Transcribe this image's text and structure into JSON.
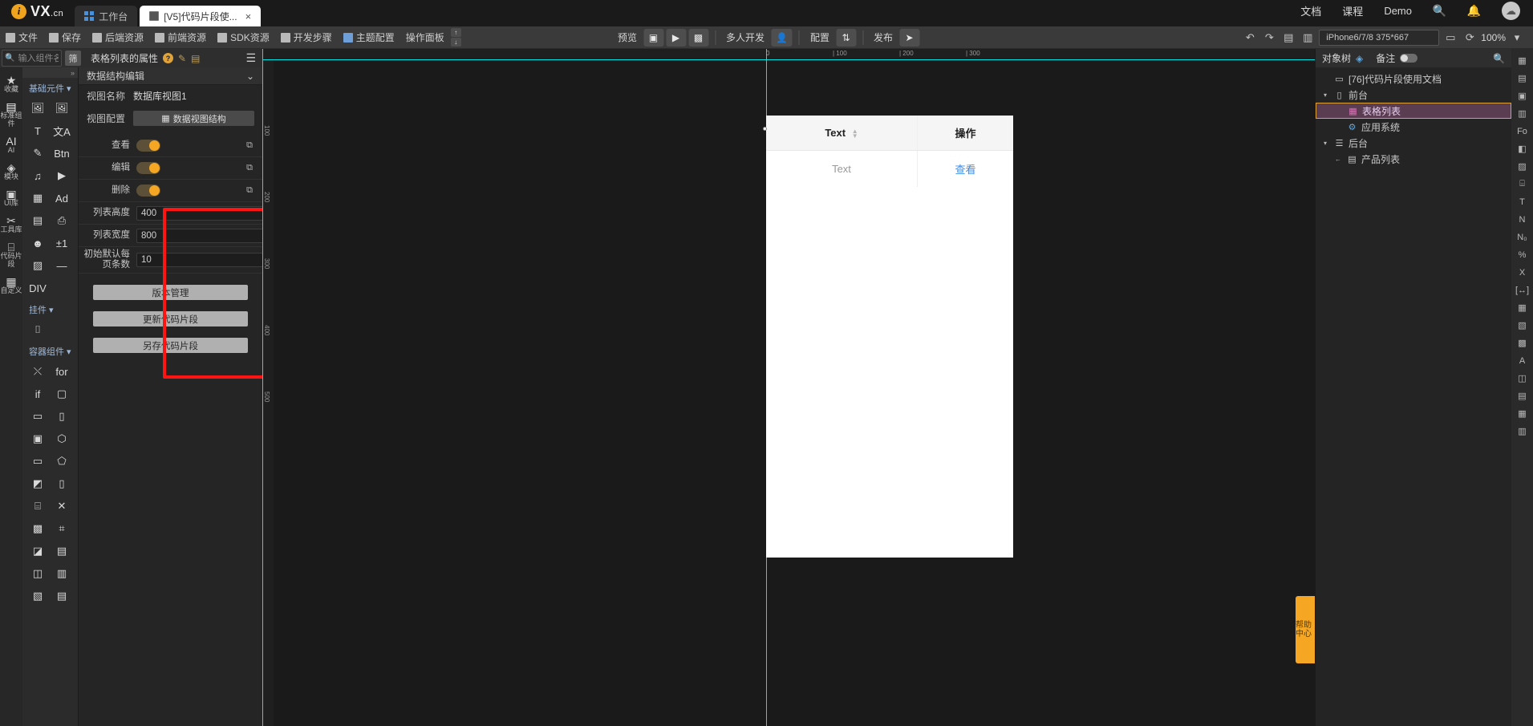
{
  "app": {
    "logo_text": "VX",
    "logo_suffix": ".cn",
    "logo_badge": "i"
  },
  "tabs": [
    {
      "label": "工作台",
      "icon": "grid-icon",
      "active": false
    },
    {
      "label": "[V5]代码片段使...",
      "icon": "monitor-icon",
      "active": true,
      "close": "×"
    }
  ],
  "top_right": {
    "items": [
      "文档",
      "课程",
      "Demo"
    ],
    "search_icon": "🔍",
    "bell_icon": "🔔",
    "avatar_icon": "☁"
  },
  "toolbar": {
    "left_items": [
      {
        "label": "文件",
        "icon": "folder-icon"
      },
      {
        "label": "保存",
        "icon": "save-icon"
      },
      {
        "label": "后端资源",
        "icon": "server-icon"
      },
      {
        "label": "前端资源",
        "icon": "blocks-icon"
      },
      {
        "label": "SDK资源",
        "icon": "sdk-icon"
      },
      {
        "label": "开发步骤",
        "icon": "steps-icon"
      },
      {
        "label": "主题配置",
        "icon": "theme-icon"
      },
      {
        "label": "操作面板",
        "icon": "panel-icon"
      }
    ],
    "stepper": {
      "up": "↑",
      "down": "↓"
    },
    "center_items": [
      {
        "label": "预览",
        "icon": ""
      },
      {
        "label": "",
        "icon": "page-play-icon"
      },
      {
        "label": "",
        "icon": "play-icon"
      },
      {
        "label": "",
        "icon": "qrcode-icon"
      },
      {
        "label": "多人开发",
        "icon": "people-icon"
      },
      {
        "label": "配置",
        "icon": "sliders-icon"
      },
      {
        "label": "发布",
        "icon": "send-icon"
      }
    ],
    "right": {
      "undo_icon": "↶",
      "redo_icon": "↷",
      "align_icon": "▤",
      "columns_icon": "▥",
      "device": "iPhone6/7/8 375*667",
      "screen_icon": "▭",
      "rotate_icon": "⟳",
      "zoom": "100%",
      "zoom_caret": "▾"
    }
  },
  "left_panel": {
    "search_placeholder": "输入组件名称",
    "filter_label": "筛",
    "collapse_icon": "»",
    "rail": [
      {
        "icon": "★",
        "label": "收藏"
      },
      {
        "icon": "▤",
        "label": "标准组件"
      },
      {
        "icon": "AI",
        "label": "AI"
      },
      {
        "icon": "◈",
        "label": "模块"
      },
      {
        "icon": "▣",
        "label": "UI库"
      },
      {
        "icon": "✂",
        "label": "工具库"
      },
      {
        "icon": "⌸",
        "label": "代码片段"
      },
      {
        "icon": "▦",
        "label": "自定义"
      }
    ],
    "groups": [
      {
        "title": "基础元件",
        "caret": "▾",
        "items": [
          "🖼",
          "🖼",
          "T",
          "文A",
          "✎",
          "Btn",
          "♫",
          "▶",
          "▦",
          "Ad",
          "▤",
          "⎙",
          "☻",
          "±1",
          "▨",
          "—",
          "DIV"
        ]
      },
      {
        "title": "挂件",
        "caret": "▾",
        "items": [
          "⌷"
        ]
      },
      {
        "title": "容器组件",
        "caret": "▾",
        "items": [
          "⤬",
          "for",
          "if",
          "▢",
          "▭",
          "▯",
          "▣",
          "⬡",
          "▭",
          "⬠",
          "◩",
          "▯",
          "⌸",
          "✕",
          "▩",
          "⌗",
          "◪",
          "▤",
          "◫",
          "▥",
          "▧",
          "▤"
        ]
      }
    ]
  },
  "props": {
    "title": "表格列表的属性",
    "help_badge": "?",
    "edit_icon": "✎",
    "note_icon": "▤",
    "menu_icon": "☰",
    "section": {
      "label": "数据结构编辑",
      "caret": "⌄"
    },
    "view_name_label": "视图名称",
    "view_name_value": "数据库视图1",
    "view_config_label": "视图配置",
    "view_config_btn": "数据视图结构",
    "view_config_icon": "▦",
    "rows": [
      {
        "label": "查看",
        "type": "toggle",
        "value": true,
        "copy_icon": "⧉"
      },
      {
        "label": "编辑",
        "type": "toggle",
        "value": true,
        "copy_icon": "⧉"
      },
      {
        "label": "删除",
        "type": "toggle",
        "value": true,
        "copy_icon": "⧉"
      },
      {
        "label": "列表高度",
        "type": "text",
        "value": "400",
        "copy_icon": "⧉"
      },
      {
        "label": "列表宽度",
        "type": "text",
        "value": "800",
        "copy_icon": "⧉"
      },
      {
        "label": "初始默认每页条数",
        "type": "text",
        "value": "10",
        "copy_icon": "⧉"
      }
    ],
    "buttons": [
      "版本管理",
      "更新代码片段",
      "另存代码片段"
    ]
  },
  "canvas": {
    "ruler_ticks_h": [
      "0",
      "100",
      "200",
      "300"
    ],
    "ruler_ticks_v": [
      "100",
      "200",
      "300",
      "400",
      "500"
    ],
    "table": {
      "headers": [
        "Text",
        "操作"
      ],
      "sort_up": "▲",
      "sort_down": "▼",
      "rows": [
        {
          "text": "Text",
          "action": "查看"
        }
      ]
    }
  },
  "right_panel": {
    "tab_label": "对象树",
    "tab_icon": "◈",
    "note_label": "备注",
    "search_icon": "🔍",
    "tree": [
      {
        "depth": 0,
        "caret": "",
        "icon": "▭",
        "label": "[76]代码片段使用文档",
        "selected": false
      },
      {
        "depth": 0,
        "caret": "▾",
        "icon": "▯",
        "label": "前台",
        "selected": false
      },
      {
        "depth": 1,
        "caret": "",
        "icon": "▦",
        "label": "表格列表",
        "selected": true
      },
      {
        "depth": 1,
        "caret": "",
        "icon": "⚙",
        "label": "应用系统",
        "selected": false
      },
      {
        "depth": 0,
        "caret": "▾",
        "icon": "☰",
        "label": "后台",
        "selected": false
      },
      {
        "depth": 1,
        "caret": "←",
        "icon": "▤",
        "label": "产品列表",
        "selected": false
      }
    ]
  },
  "far_rail": {
    "items": [
      "▦",
      "▤",
      "▣",
      "▥",
      "Fo",
      "◧",
      "▨",
      "⌸",
      "T",
      "N",
      "N₀",
      "%",
      "X",
      "[↔]",
      "▦",
      "▧",
      "▩",
      "A",
      "◫",
      "▤",
      "▦",
      "▥"
    ]
  },
  "help_float": {
    "label": "帮助中心",
    "icon": "?"
  }
}
